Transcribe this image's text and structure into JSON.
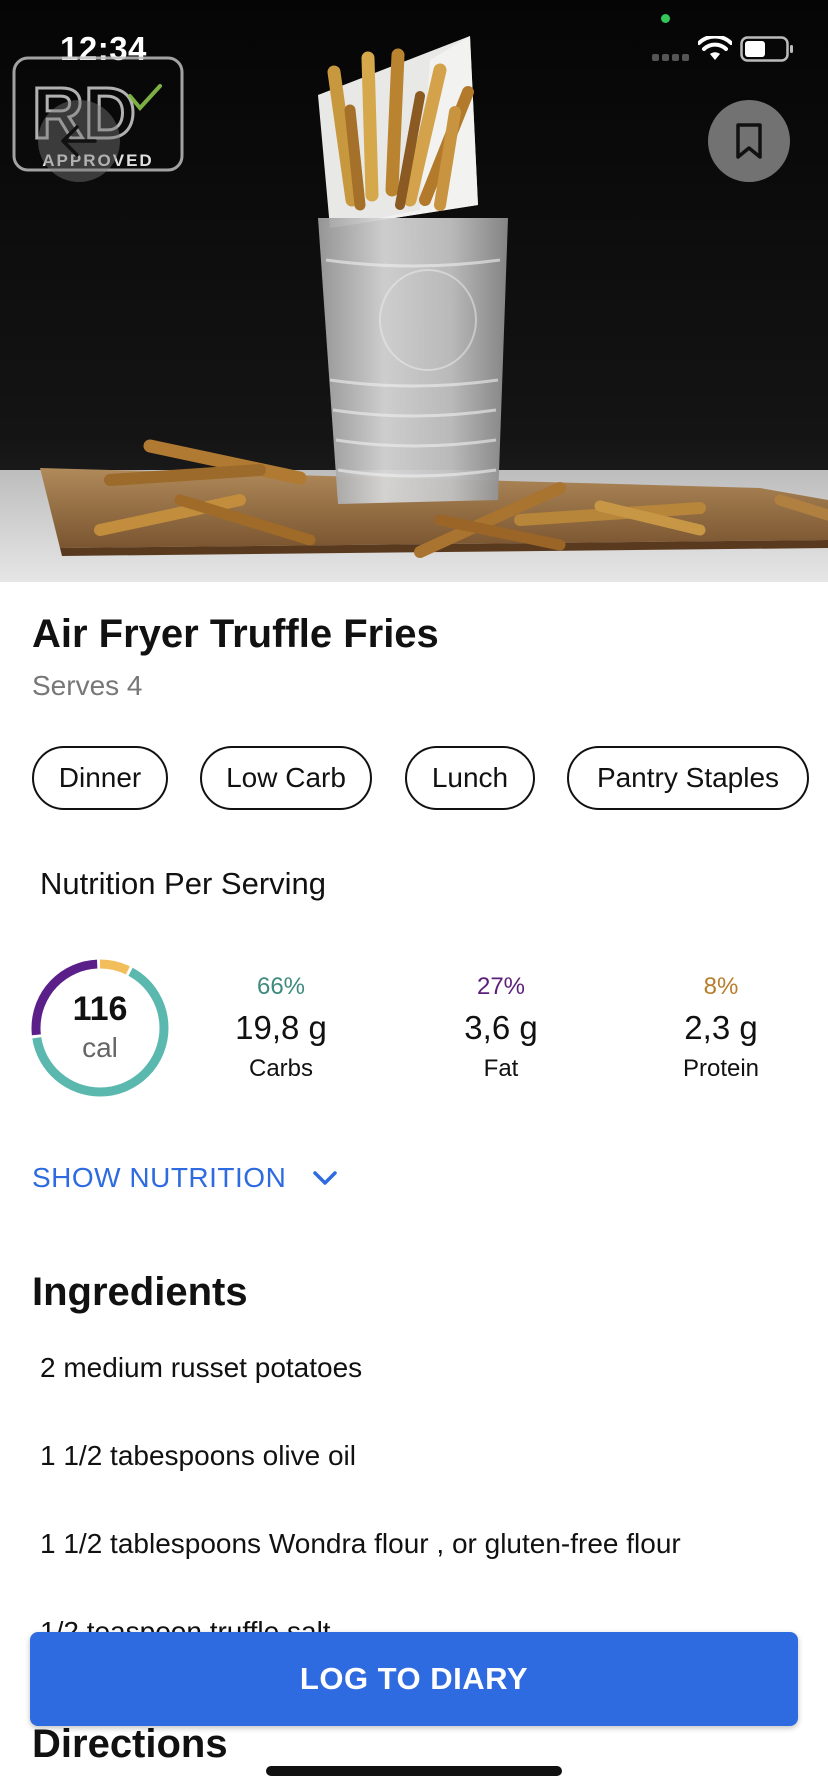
{
  "status_bar": {
    "time": "12:34"
  },
  "hero": {
    "badge_text": "APPROVED",
    "badge_letters": "RD"
  },
  "recipe": {
    "title": "Air Fryer Truffle Fries",
    "serves": "Serves 4",
    "tags": [
      "Dinner",
      "Low Carb",
      "Lunch",
      "Pantry Staples"
    ]
  },
  "nutrition": {
    "heading": "Nutrition Per Serving",
    "calories": "116",
    "calories_unit": "cal",
    "macros": [
      {
        "pct": "66%",
        "grams": "19,8 g",
        "label": "Carbs",
        "color": "#3f8a7e"
      },
      {
        "pct": "27%",
        "grams": "3,6 g",
        "label": "Fat",
        "color": "#5b1f7a"
      },
      {
        "pct": "8%",
        "grams": "2,3 g",
        "label": "Protein",
        "color": "#b87d2a"
      }
    ],
    "ring_shares": {
      "carbs": 0.66,
      "fat": 0.27,
      "protein": 0.08
    },
    "ring_colors": {
      "carbs": "#5bb8ae",
      "fat": "#5b1f8a",
      "protein": "#f2be5c"
    },
    "show_label": "SHOW NUTRITION"
  },
  "ingredients": {
    "heading": "Ingredients",
    "items": [
      "2 medium russet potatoes",
      "1 1/2 tabespoons olive oil",
      "1 1/2 tablespoons Wondra flour , or gluten-free flour",
      "1/2 teaspoon truffle salt"
    ]
  },
  "directions": {
    "heading": "Directions"
  },
  "actions": {
    "log_label": "LOG TO DIARY"
  },
  "colors": {
    "accent": "#2f6be0"
  }
}
